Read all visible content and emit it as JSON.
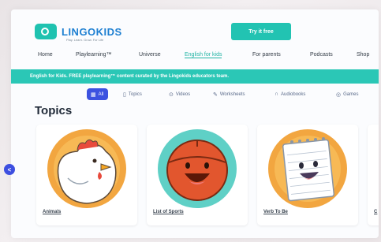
{
  "header": {
    "logo_text": "LINGOKIDS",
    "logo_tagline": "Play. Learn. Grow. For Life",
    "cta_label": "Try it free"
  },
  "nav": {
    "items": [
      {
        "label": "Home"
      },
      {
        "label": "Playlearning™"
      },
      {
        "label": "Universe"
      },
      {
        "label": "English for kids"
      },
      {
        "label": "For parents"
      },
      {
        "label": "Podcasts"
      },
      {
        "label": "Shop"
      }
    ],
    "active_index": 3
  },
  "banner": {
    "text": "English for Kids. FREE playlearning™ content curated by the Lingokids educators team."
  },
  "filters": [
    {
      "label": "All",
      "icon": "grid-icon",
      "active": true
    },
    {
      "label": "Topics",
      "icon": "page-icon",
      "active": false
    },
    {
      "label": "Videos",
      "icon": "play-icon",
      "active": false
    },
    {
      "label": "Worksheets",
      "icon": "pencil-icon",
      "active": false
    },
    {
      "label": "Audiobooks",
      "icon": "headphones-icon",
      "active": false
    },
    {
      "label": "Games",
      "icon": "gamepad-icon",
      "active": false
    }
  ],
  "section": {
    "title": "Topics"
  },
  "cards": [
    {
      "label": "Animals",
      "art": "chicken-illustration",
      "bg": "#f2a640"
    },
    {
      "label": "List of Sports",
      "art": "basketball-illustration",
      "bg": "#5fd0c6"
    },
    {
      "label": "Verb To Be",
      "art": "notepad-illustration",
      "bg": "#f2a640"
    },
    {
      "label": "C",
      "art": "partial-card",
      "bg": "#6cc7e8"
    }
  ],
  "colors": {
    "accent": "#22c3b2",
    "brand_blue": "#1d7fd1",
    "filter_active": "#3c52e0"
  }
}
